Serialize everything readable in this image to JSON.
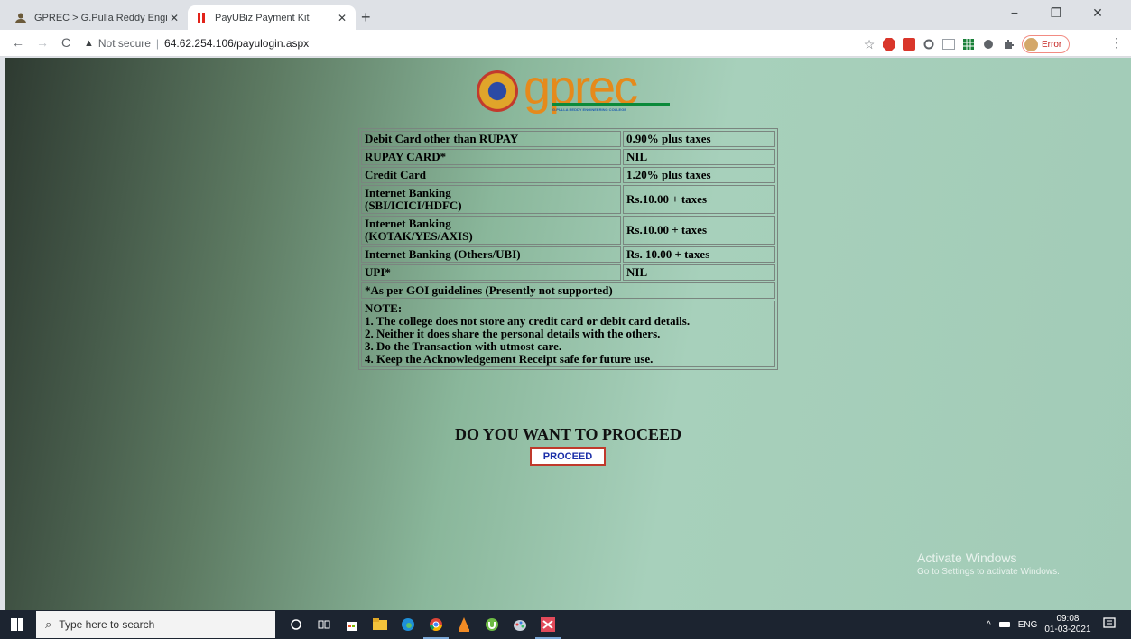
{
  "browser": {
    "tabs": [
      {
        "title": "GPREC > G.Pulla Reddy Enginee",
        "active": false,
        "icon": "person-icon"
      },
      {
        "title": "PayUBiz Payment Kit",
        "active": true,
        "icon": "payu-icon"
      }
    ],
    "new_tab": "+",
    "window_controls": {
      "minimize": "−",
      "maximize": "❐",
      "close": "✕"
    },
    "nav": {
      "back": "←",
      "forward": "→",
      "reload": "C"
    },
    "address": {
      "security": "Not secure",
      "url": "64.62.254.106/payulogin.aspx"
    },
    "bookmark_star": "☆",
    "extensions": [
      "abp-icon",
      "pdf-icon",
      "circle-icon",
      "mail-icon",
      "sheets-icon",
      "puzzle-gear-icon",
      "puzzle-icon"
    ],
    "profile_button": "Error",
    "menu": "⋮"
  },
  "page": {
    "logo": {
      "text": "gprec",
      "subtitle": "G.PULLA REDDY ENGINEERING COLLEGE"
    },
    "fees": [
      {
        "method": "Debit Card other than RUPAY",
        "charge": "0.90% plus taxes"
      },
      {
        "method": "RUPAY CARD*",
        "charge": "NIL"
      },
      {
        "method": "Credit Card",
        "charge": "1.20% plus taxes"
      },
      {
        "method": "Internet Banking",
        "method2": "(SBI/ICICI/HDFC)",
        "charge": "Rs.10.00 + taxes"
      },
      {
        "method": "Internet Banking",
        "method2": "(KOTAK/YES/AXIS)",
        "charge": "Rs.10.00 + taxes"
      },
      {
        "method": "Internet Banking (Others/UBI)",
        "charge": "Rs. 10.00 + taxes"
      },
      {
        "method": "UPI*",
        "charge": "NIL"
      }
    ],
    "footnote": "*As per GOI guidelines (Presently not supported)",
    "note": {
      "heading": "NOTE:",
      "lines": [
        "1. The college does not store any credit card or debit card details.",
        "2. Neither it does share the personal details with the others.",
        "3. Do the Transaction with utmost care.",
        "4. Keep the Acknowledgement Receipt safe for future use."
      ]
    },
    "question": "DO YOU WANT TO PROCEED",
    "proceed_label": "PROCEED",
    "watermark": {
      "line1": "Activate Windows",
      "line2": "Go to Settings to activate Windows."
    }
  },
  "taskbar": {
    "search_placeholder": "Type here to search",
    "apps": [
      "cortana-icon",
      "task-view-icon",
      "store-icon",
      "file-explorer-icon",
      "edge-icon",
      "chrome-icon",
      "vlc-icon",
      "utorrent-icon",
      "paint-icon",
      "pdf-app-icon"
    ],
    "tray": {
      "chevron": "^",
      "language": "ENG",
      "time": "09:08",
      "date": "01-03-2021"
    }
  }
}
